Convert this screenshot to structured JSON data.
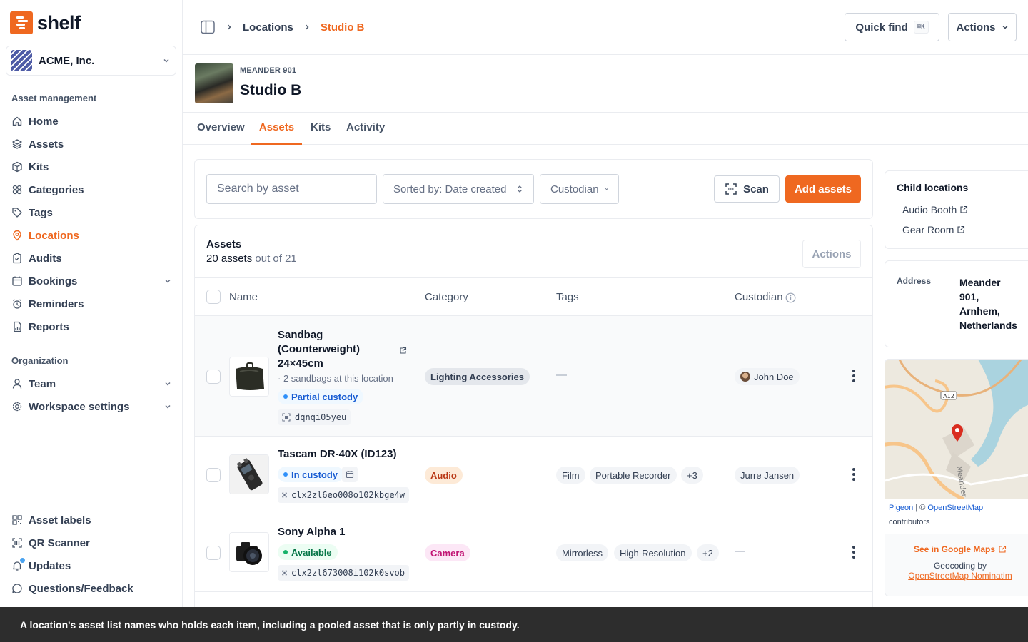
{
  "app": {
    "name": "shelf",
    "brand_color": "#ef6820"
  },
  "workspace": {
    "name": "ACME, Inc."
  },
  "sidebar": {
    "section_asset": "Asset management",
    "items": [
      {
        "label": "Home",
        "icon": "home-icon"
      },
      {
        "label": "Assets",
        "icon": "assets-icon"
      },
      {
        "label": "Kits",
        "icon": "kits-icon"
      },
      {
        "label": "Categories",
        "icon": "categories-icon"
      },
      {
        "label": "Tags",
        "icon": "tag-icon"
      },
      {
        "label": "Locations",
        "icon": "map-pin-icon",
        "active": true
      },
      {
        "label": "Audits",
        "icon": "audit-icon"
      },
      {
        "label": "Bookings",
        "icon": "calendar-icon"
      },
      {
        "label": "Reminders",
        "icon": "alarm-icon"
      },
      {
        "label": "Reports",
        "icon": "report-icon"
      }
    ],
    "section_org": "Organization",
    "org_items": [
      {
        "label": "Team",
        "icon": "user-icon"
      },
      {
        "label": "Workspace settings",
        "icon": "gear-icon"
      }
    ],
    "bottom_items": [
      {
        "label": "Asset labels",
        "icon": "qr-icon"
      },
      {
        "label": "QR Scanner",
        "icon": "scan-icon"
      },
      {
        "label": "Updates",
        "icon": "bell-icon"
      },
      {
        "label": "Questions/Feedback",
        "icon": "message-icon"
      }
    ]
  },
  "header": {
    "breadcrumb": [
      "Locations",
      "Studio B"
    ],
    "quick_find": "Quick find",
    "quick_find_kbd": "⌘K",
    "actions": "Actions"
  },
  "location": {
    "subtitle": "MEANDER 901",
    "title": "Studio B"
  },
  "tabs": [
    "Overview",
    "Assets",
    "Kits",
    "Activity"
  ],
  "filters": {
    "search_placeholder": "Search by asset",
    "sort": "Sorted by: Date created",
    "custodian": "Custodian",
    "scan": "Scan",
    "add": "Add assets"
  },
  "table": {
    "title": "Assets",
    "count": "20 assets",
    "count_suffix": "out of 21",
    "actions": "Actions",
    "columns": [
      "Name",
      "Category",
      "Tags",
      "Custodian"
    ],
    "rows": [
      {
        "name": "Sandbag (Counterweight) 24×45cm",
        "name_lines": [
          "Sandbag",
          "(Counterweight)",
          "24×45cm"
        ],
        "meta": "· 2 sandbags at this location",
        "status": "Partial custody",
        "code": "dqnqi05yeu",
        "category": "Lighting Accessories",
        "tags_empty": "—",
        "custodian": "John Doe"
      },
      {
        "name": "Tascam DR-40X (ID123)",
        "status": "In custody",
        "code": "clx2zl6eo008o102kbge4w",
        "category": "Audio",
        "tags": [
          "Film",
          "Portable Recorder",
          "+3"
        ],
        "custodian": "Jurre Jansen"
      },
      {
        "name": "Sony Alpha 1",
        "status": "Available",
        "code": "clx2zl673008i102k0svob",
        "category": "Camera",
        "tags": [
          "Mirrorless",
          "High-Resolution",
          "+2"
        ],
        "custodian_empty": "—"
      }
    ]
  },
  "right_panel": {
    "child_title": "Child locations",
    "children": [
      "Audio Booth",
      "Gear Room"
    ],
    "address_label": "Address",
    "address": [
      "Meander",
      "901,",
      "Arnhem,",
      "Netherlands"
    ],
    "map_road": "A12",
    "map_street": "Meander",
    "attribution_1": "Pigeon",
    "attribution_sep": " | © ",
    "attribution_2": "OpenStreetMap",
    "attribution_3": "contributors",
    "google_link": "See in Google Maps",
    "geocoding": "Geocoding by",
    "nominatim": "OpenStreetMap Nominatim"
  },
  "caption": "A location's asset list names who holds each item, including a pooled asset that is only partly in custody."
}
